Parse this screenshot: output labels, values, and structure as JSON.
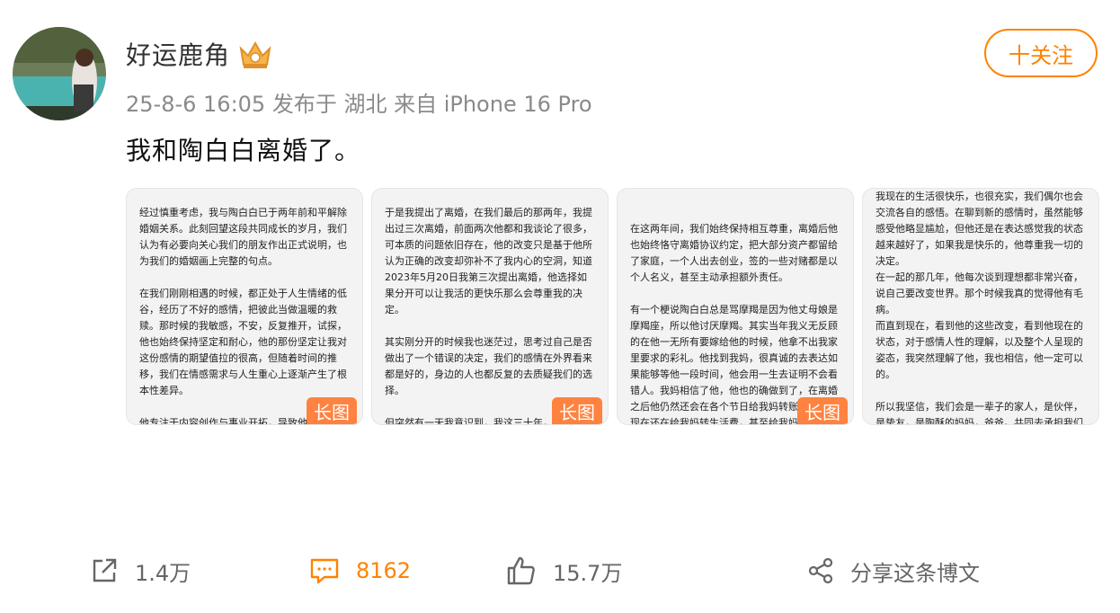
{
  "post": {
    "username": "好运鹿角",
    "meta": "25-8-6 16:05  发布于 湖北  来自 iPhone 16 Pro",
    "follow_label": "十关注",
    "content": "我和陶白白离婚了。"
  },
  "images": [
    {
      "text": "\n经过慎重考虑，我与陶白白已于两年前和平解除婚姻关系。此刻回望这段共同成长的岁月，我们认为有必要向关心我们的朋友作出正式说明，也为我们的婚姻画上完整的句点。\n\n在我们刚刚相遇的时候，都正处于人生情绪的低谷，经历了不好的感情，把彼此当做温暖的救赎。那时候的我敏感，不安，反复推开，试探，他也始终保持坚定和耐心，他的那份坚定让我对这份感情的期望值拉的很高，但随着时间的推移，我们在情感需求与人生重心上逐渐产生了根本性差异。\n\n他专注于内容创作与事业开拓，导致他情绪不太稳定，对感情的态度越来越平淡，逐渐将",
      "badge": "长图"
    },
    {
      "text": "\n于是我提出了离婚，在我们最后的那两年，我提出过三次离婚，前面两次他都和我谈论了很多，可本质的问题依旧存在，他的改变只是基于他所认为正确的改变却弥补不了我内心的空洞，知道2023年5月20日我第三次提出离婚，他选择如果分开可以让我活的更快乐那么会尊重我的决定。\n\n其实刚分开的时候我也迷茫过，思考过自己是否做出了一个错误的决定，我们的感情在外界看来都是好的，身边的人也都反复的去质疑我们的选择。\n\n但突然有一天我意识到，我这三十年，都在被所谓的命运、舆论、家庭责任所束缚，做什么事情都在想什么该做什么不该做，我努力扮演好女儿",
      "badge": "长图"
    },
    {
      "text": "\n\n在这两年间，我们始终保持相互尊重，离婚后他也始终恪守离婚协议约定，把大部分资产都留给了家庭，一个人出去创业，签的一些对赌都是以个人名义，甚至主动承担额外责任。\n\n有一个梗说陶白白总是骂摩羯是因为他丈母娘是摩羯座，所以他讨厌摩羯。其实当年我义无反顾的在他一无所有要嫁给他的时候，他拿不出我家里要求的彩礼。他找到我妈，很真诚的去表达如果能够等他一段时间，他会用一生去证明不会看错人。我妈相信了他，他也的确做到了，在离婚之后他仍然还会在各个节日给我妈转账，并直到现在还在给我妈转生活费，甚至给我妈开导情感问题。",
      "badge": "长图"
    },
    {
      "text": "我现在的生活很快乐，也很充实，我们偶尔也会交流各自的感悟。在聊到新的感情时，虽然能够感受他略显尴尬，但他还是在表达感觉我的状态越来越好了，如果我是快乐的，他尊重我一切的决定。\n在一起的那几年，他每次谈到理想都非常兴奋，说自己要改变世界。那个时候我真的觉得他有毛病。\n而直到现在，看到他的这些改变，看到他现在的状态，对于感情人性的理解，以及整个人呈现的姿态，我突然理解了他，我也相信，他一定可以的。\n\n所以我坚信，我们会是一辈子的家人，是伙伴，是挚友，是陶酥的妈妈，爸爸。共同去承担我们应尽的义务让陶酥在更好的环境中成长。\n\n我也希望大家都能越来越好，不要在困境中束缚自",
      "badge": ""
    }
  ],
  "actions": {
    "share_count": "1.4万",
    "comment_count": "8162",
    "like_count": "15.7万",
    "share_post_label": "分享这条博文"
  },
  "colors": {
    "accent": "#ff8200",
    "badge": "#ff8240"
  },
  "icons": [
    "repost-icon",
    "comment-icon",
    "like-icon",
    "share-icon",
    "crown-badge-icon"
  ]
}
